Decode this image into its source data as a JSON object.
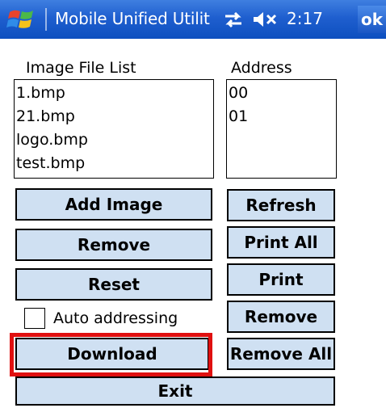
{
  "titlebar": {
    "title": "Mobile Unified Utilit",
    "time": "2:17",
    "ok_label": "ok",
    "icons": [
      "windows-start-icon",
      "sync-icon",
      "speaker-muted-icon"
    ]
  },
  "image_list": {
    "label": "Image File List",
    "items": [
      "1.bmp",
      "21.bmp",
      "logo.bmp",
      "test.bmp"
    ]
  },
  "address_list": {
    "label": "Address",
    "items": [
      "00",
      "01"
    ]
  },
  "buttons": {
    "add_image": "Add Image",
    "remove_left": "Remove",
    "reset": "Reset",
    "download": "Download",
    "refresh": "Refresh",
    "print_all": "Print All",
    "print": "Print",
    "remove_right": "Remove",
    "remove_all": "Remove All",
    "exit": "Exit"
  },
  "auto_addressing": {
    "label": "Auto addressing",
    "checked": false
  },
  "colors": {
    "button_bg": "#cfe0f2",
    "titlebar": "#1f5fcf",
    "highlight": "#e01010"
  }
}
